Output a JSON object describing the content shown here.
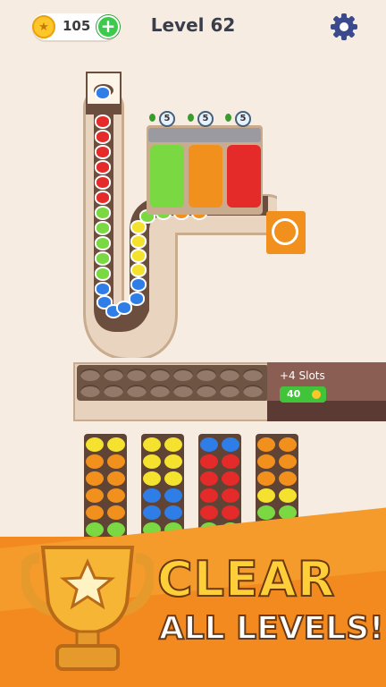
{
  "header": {
    "coins": "105",
    "add_coins_label": "+",
    "level": "Level 62",
    "settings_icon": "gear-icon"
  },
  "boxes": [
    {
      "color": "green",
      "remaining": "5"
    },
    {
      "color": "orange",
      "remaining": "5"
    },
    {
      "color": "red",
      "remaining": "5"
    }
  ],
  "slots_offer": {
    "label": "+4 Slots",
    "price": "40"
  },
  "banner": {
    "line1": "CLEAR",
    "line2": "ALL LEVELS!"
  },
  "colors": {
    "red": "#e52a2a",
    "green": "#7ad843",
    "yellow": "#f5e22e",
    "blue": "#2f7de6",
    "orange": "#f2901d",
    "accent": "#f28a1f"
  }
}
